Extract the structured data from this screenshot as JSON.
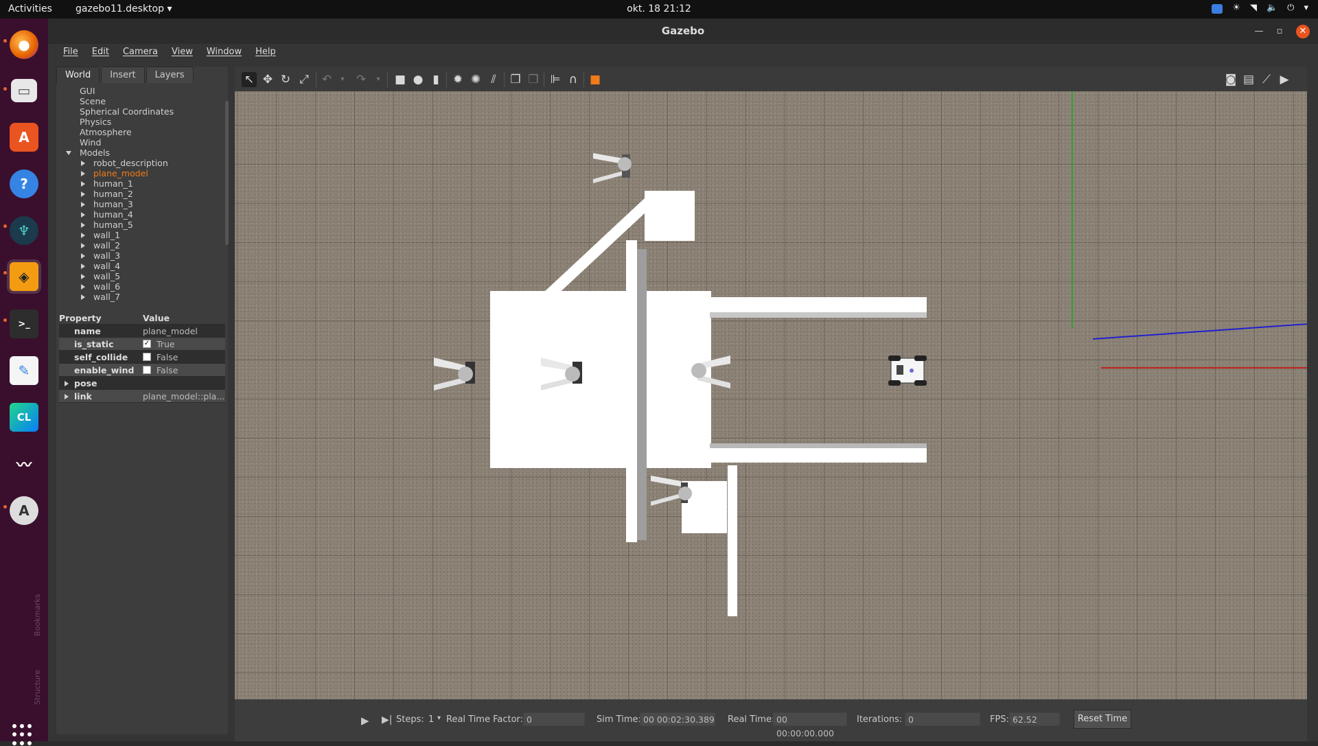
{
  "topbar": {
    "activities": "Activities",
    "app_menu": "gazebo11.desktop ▾",
    "clock": "okt. 18  21:12"
  },
  "dock": {
    "items": [
      {
        "name": "firefox-icon"
      },
      {
        "name": "files-icon"
      },
      {
        "name": "software-center-icon"
      },
      {
        "name": "help-icon"
      },
      {
        "name": "gitkraken-icon"
      },
      {
        "name": "gazebo-icon"
      },
      {
        "name": "terminal-icon"
      },
      {
        "name": "text-editor-icon"
      },
      {
        "name": "clion-icon"
      },
      {
        "name": "system-monitor-icon"
      },
      {
        "name": "software-updater-icon"
      }
    ],
    "side_labels": [
      "Bookmarks",
      "Structure"
    ]
  },
  "window": {
    "title": "Gazebo",
    "menus": [
      "File",
      "Edit",
      "Camera",
      "View",
      "Window",
      "Help"
    ]
  },
  "left_panel": {
    "tabs": [
      "World",
      "Insert",
      "Layers"
    ],
    "tree": {
      "root_items": [
        "GUI",
        "Scene",
        "Spherical Coordinates",
        "Physics",
        "Atmosphere",
        "Wind"
      ],
      "models_label": "Models",
      "models": [
        "robot_description",
        "plane_model",
        "human_1",
        "human_2",
        "human_3",
        "human_4",
        "human_5",
        "wall_1",
        "wall_2",
        "wall_3",
        "wall_4",
        "wall_5",
        "wall_6",
        "wall_7"
      ],
      "selected": "plane_model"
    },
    "properties": {
      "header_property": "Property",
      "header_value": "Value",
      "rows": [
        {
          "key": "name",
          "value": "plane_model"
        },
        {
          "key": "is_static",
          "value": "True",
          "checked": true
        },
        {
          "key": "self_collide",
          "value": "False",
          "checked": false
        },
        {
          "key": "enable_wind",
          "value": "False",
          "checked": false
        },
        {
          "key": "pose",
          "value": ""
        },
        {
          "key": "link",
          "value": "plane_model::pla..."
        }
      ]
    }
  },
  "bottom_bar": {
    "steps_label": "Steps:",
    "steps_value": "1",
    "rtf_label": "Real Time Factor:",
    "rtf_value": "0",
    "sim_time_label": "Sim Time:",
    "sim_time_value": "00 00:02:30.389",
    "real_time_label": "Real Time:",
    "real_time_value": "00 00:00:00.000",
    "iterations_label": "Iterations:",
    "iterations_value": "0",
    "fps_label": "FPS:",
    "fps_value": "62.52",
    "reset_label": "Reset Time"
  },
  "colors": {
    "accent_selected": "#f07c19",
    "dock_bg": "#3a0f2d",
    "window_close": "#e95420"
  }
}
